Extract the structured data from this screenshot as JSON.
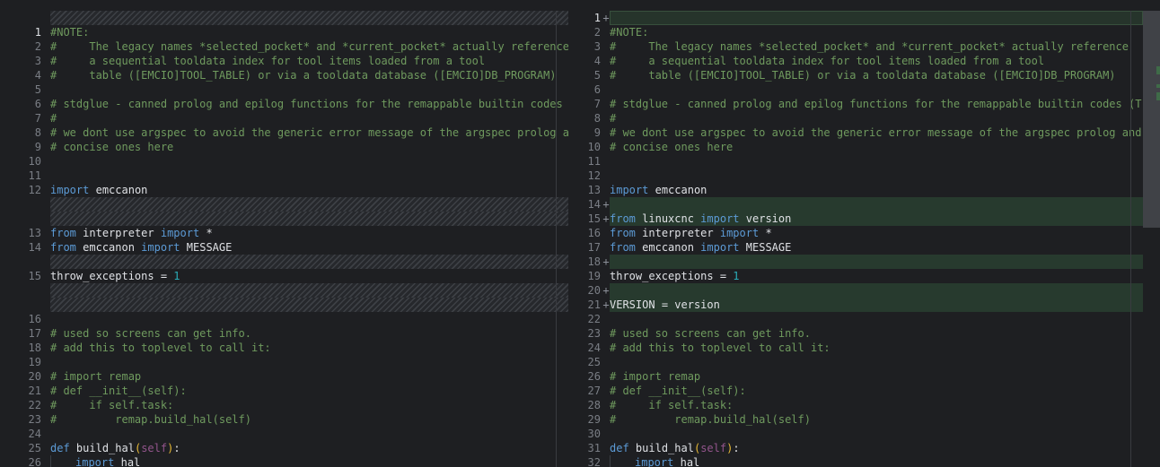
{
  "left": {
    "rows": [
      {
        "kind": "filler"
      },
      {
        "n": "1",
        "current": true,
        "t": [
          [
            "cm",
            "#NOTE:"
          ]
        ]
      },
      {
        "n": "2",
        "t": [
          [
            "cm",
            "#     The legacy names *selected_pocket* and *current_pocket* actually reference"
          ]
        ]
      },
      {
        "n": "3",
        "t": [
          [
            "cm",
            "#     a sequential tooldata index for tool items loaded from a tool"
          ]
        ]
      },
      {
        "n": "4",
        "t": [
          [
            "cm",
            "#     table ([EMCIO]TOOL_TABLE) or via a tooldata database ([EMCIO]DB_PROGRAM)"
          ]
        ]
      },
      {
        "n": "5",
        "t": []
      },
      {
        "n": "6",
        "t": [
          [
            "cm",
            "# stdglue - canned prolog and epilog functions for the remappable builtin codes"
          ]
        ]
      },
      {
        "n": "7",
        "t": [
          [
            "cm",
            "#"
          ]
        ]
      },
      {
        "n": "8",
        "t": [
          [
            "cm",
            "# we dont use argspec to avoid the generic error message of the argspec prolog a"
          ]
        ]
      },
      {
        "n": "9",
        "t": [
          [
            "cm",
            "# concise ones here"
          ]
        ]
      },
      {
        "n": "10",
        "t": []
      },
      {
        "n": "11",
        "t": []
      },
      {
        "n": "12",
        "t": [
          [
            "kw",
            "import"
          ],
          [
            "p",
            " "
          ],
          [
            "id",
            "emccanon"
          ]
        ]
      },
      {
        "kind": "filler"
      },
      {
        "kind": "filler"
      },
      {
        "n": "13",
        "t": [
          [
            "kw",
            "from"
          ],
          [
            "p",
            " "
          ],
          [
            "id",
            "interpreter"
          ],
          [
            "p",
            " "
          ],
          [
            "kw",
            "import"
          ],
          [
            "p",
            " "
          ],
          [
            "id",
            "*"
          ]
        ]
      },
      {
        "n": "14",
        "t": [
          [
            "kw",
            "from"
          ],
          [
            "p",
            " "
          ],
          [
            "id",
            "emccanon"
          ],
          [
            "p",
            " "
          ],
          [
            "kw",
            "import"
          ],
          [
            "p",
            " "
          ],
          [
            "id",
            "MESSAGE"
          ]
        ]
      },
      {
        "kind": "filler"
      },
      {
        "n": "15",
        "t": [
          [
            "id",
            "throw_exceptions"
          ],
          [
            "p",
            " "
          ],
          [
            "id",
            "="
          ],
          [
            "p",
            " "
          ],
          [
            "num",
            "1"
          ]
        ]
      },
      {
        "kind": "filler"
      },
      {
        "kind": "filler"
      },
      {
        "n": "16",
        "t": []
      },
      {
        "n": "17",
        "t": [
          [
            "cm",
            "# used so screens can get info."
          ]
        ]
      },
      {
        "n": "18",
        "t": [
          [
            "cm",
            "# add this to toplevel to call it:"
          ]
        ]
      },
      {
        "n": "19",
        "t": []
      },
      {
        "n": "20",
        "t": [
          [
            "cm",
            "# import remap"
          ]
        ]
      },
      {
        "n": "21",
        "t": [
          [
            "cm",
            "# def __init__(self):"
          ]
        ]
      },
      {
        "n": "22",
        "t": [
          [
            "cm",
            "#     if self.task:"
          ]
        ]
      },
      {
        "n": "23",
        "t": [
          [
            "cm",
            "#         remap.build_hal(self)"
          ]
        ]
      },
      {
        "n": "24",
        "t": []
      },
      {
        "n": "25",
        "t": [
          [
            "kw",
            "def"
          ],
          [
            "p",
            " "
          ],
          [
            "id",
            "build_hal"
          ],
          [
            "par",
            "("
          ],
          [
            "slf",
            "self"
          ],
          [
            "par",
            ")"
          ],
          [
            "id",
            ":"
          ]
        ]
      },
      {
        "n": "26",
        "indent": 1,
        "t": [
          [
            "kw",
            "import"
          ],
          [
            "p",
            " "
          ],
          [
            "id",
            "hal"
          ]
        ]
      }
    ]
  },
  "right": {
    "rows": [
      {
        "n": "1",
        "current": true,
        "marker": "+",
        "t": []
      },
      {
        "n": "2",
        "t": [
          [
            "cm",
            "#NOTE:"
          ]
        ]
      },
      {
        "n": "3",
        "t": [
          [
            "cm",
            "#     The legacy names *selected_pocket* and *current_pocket* actually reference"
          ]
        ]
      },
      {
        "n": "4",
        "t": [
          [
            "cm",
            "#     a sequential tooldata index for tool items loaded from a tool"
          ]
        ]
      },
      {
        "n": "5",
        "t": [
          [
            "cm",
            "#     table ([EMCIO]TOOL_TABLE) or via a tooldata database ([EMCIO]DB_PROGRAM)"
          ]
        ]
      },
      {
        "n": "6",
        "t": []
      },
      {
        "n": "7",
        "t": [
          [
            "cm",
            "# stdglue - canned prolog and epilog functions for the remappable builtin codes (T,"
          ]
        ]
      },
      {
        "n": "8",
        "t": [
          [
            "cm",
            "#"
          ]
        ]
      },
      {
        "n": "9",
        "t": [
          [
            "cm",
            "# we dont use argspec to avoid the generic error message of the argspec prolog and"
          ]
        ]
      },
      {
        "n": "10",
        "t": [
          [
            "cm",
            "# concise ones here"
          ]
        ]
      },
      {
        "n": "11",
        "t": []
      },
      {
        "n": "12",
        "t": []
      },
      {
        "n": "13",
        "t": [
          [
            "kw",
            "import"
          ],
          [
            "p",
            " "
          ],
          [
            "id",
            "emccanon"
          ]
        ]
      },
      {
        "n": "14",
        "added": true,
        "marker": "+",
        "t": []
      },
      {
        "n": "15",
        "added": true,
        "marker": "+",
        "t": [
          [
            "kw",
            "from"
          ],
          [
            "p",
            " "
          ],
          [
            "id",
            "linuxcnc"
          ],
          [
            "p",
            " "
          ],
          [
            "kw",
            "import"
          ],
          [
            "p",
            " "
          ],
          [
            "id",
            "version"
          ]
        ]
      },
      {
        "n": "16",
        "t": [
          [
            "kw",
            "from"
          ],
          [
            "p",
            " "
          ],
          [
            "id",
            "interpreter"
          ],
          [
            "p",
            " "
          ],
          [
            "kw",
            "import"
          ],
          [
            "p",
            " "
          ],
          [
            "id",
            "*"
          ]
        ]
      },
      {
        "n": "17",
        "t": [
          [
            "kw",
            "from"
          ],
          [
            "p",
            " "
          ],
          [
            "id",
            "emccanon"
          ],
          [
            "p",
            " "
          ],
          [
            "kw",
            "import"
          ],
          [
            "p",
            " "
          ],
          [
            "id",
            "MESSAGE"
          ]
        ]
      },
      {
        "n": "18",
        "added": true,
        "marker": "+",
        "t": []
      },
      {
        "n": "19",
        "t": [
          [
            "id",
            "throw_exceptions"
          ],
          [
            "p",
            " "
          ],
          [
            "id",
            "="
          ],
          [
            "p",
            " "
          ],
          [
            "num",
            "1"
          ]
        ]
      },
      {
        "n": "20",
        "added": true,
        "marker": "+",
        "t": []
      },
      {
        "n": "21",
        "added": true,
        "marker": "+",
        "t": [
          [
            "id",
            "VERSION"
          ],
          [
            "p",
            " "
          ],
          [
            "id",
            "="
          ],
          [
            "p",
            " "
          ],
          [
            "id",
            "version"
          ]
        ]
      },
      {
        "n": "22",
        "t": []
      },
      {
        "n": "23",
        "t": [
          [
            "cm",
            "# used so screens can get info."
          ]
        ]
      },
      {
        "n": "24",
        "t": [
          [
            "cm",
            "# add this to toplevel to call it:"
          ]
        ]
      },
      {
        "n": "25",
        "t": []
      },
      {
        "n": "26",
        "t": [
          [
            "cm",
            "# import remap"
          ]
        ]
      },
      {
        "n": "27",
        "t": [
          [
            "cm",
            "# def __init__(self):"
          ]
        ]
      },
      {
        "n": "28",
        "t": [
          [
            "cm",
            "#     if self.task:"
          ]
        ]
      },
      {
        "n": "29",
        "t": [
          [
            "cm",
            "#         remap.build_hal(self)"
          ]
        ]
      },
      {
        "n": "30",
        "t": []
      },
      {
        "n": "31",
        "t": [
          [
            "kw",
            "def"
          ],
          [
            "p",
            " "
          ],
          [
            "id",
            "build_hal"
          ],
          [
            "par",
            "("
          ],
          [
            "slf",
            "self"
          ],
          [
            "par",
            ")"
          ],
          [
            "id",
            ":"
          ]
        ]
      },
      {
        "n": "32",
        "indent": 1,
        "t": [
          [
            "kw",
            "import"
          ],
          [
            "p",
            " "
          ],
          [
            "id",
            "hal"
          ]
        ]
      }
    ]
  },
  "colors": {
    "background": "#1e1f22",
    "added_line": "#273a2e",
    "keyword": "#5c9bd6",
    "comment": "#6f9a5e",
    "number": "#2aacb8"
  }
}
